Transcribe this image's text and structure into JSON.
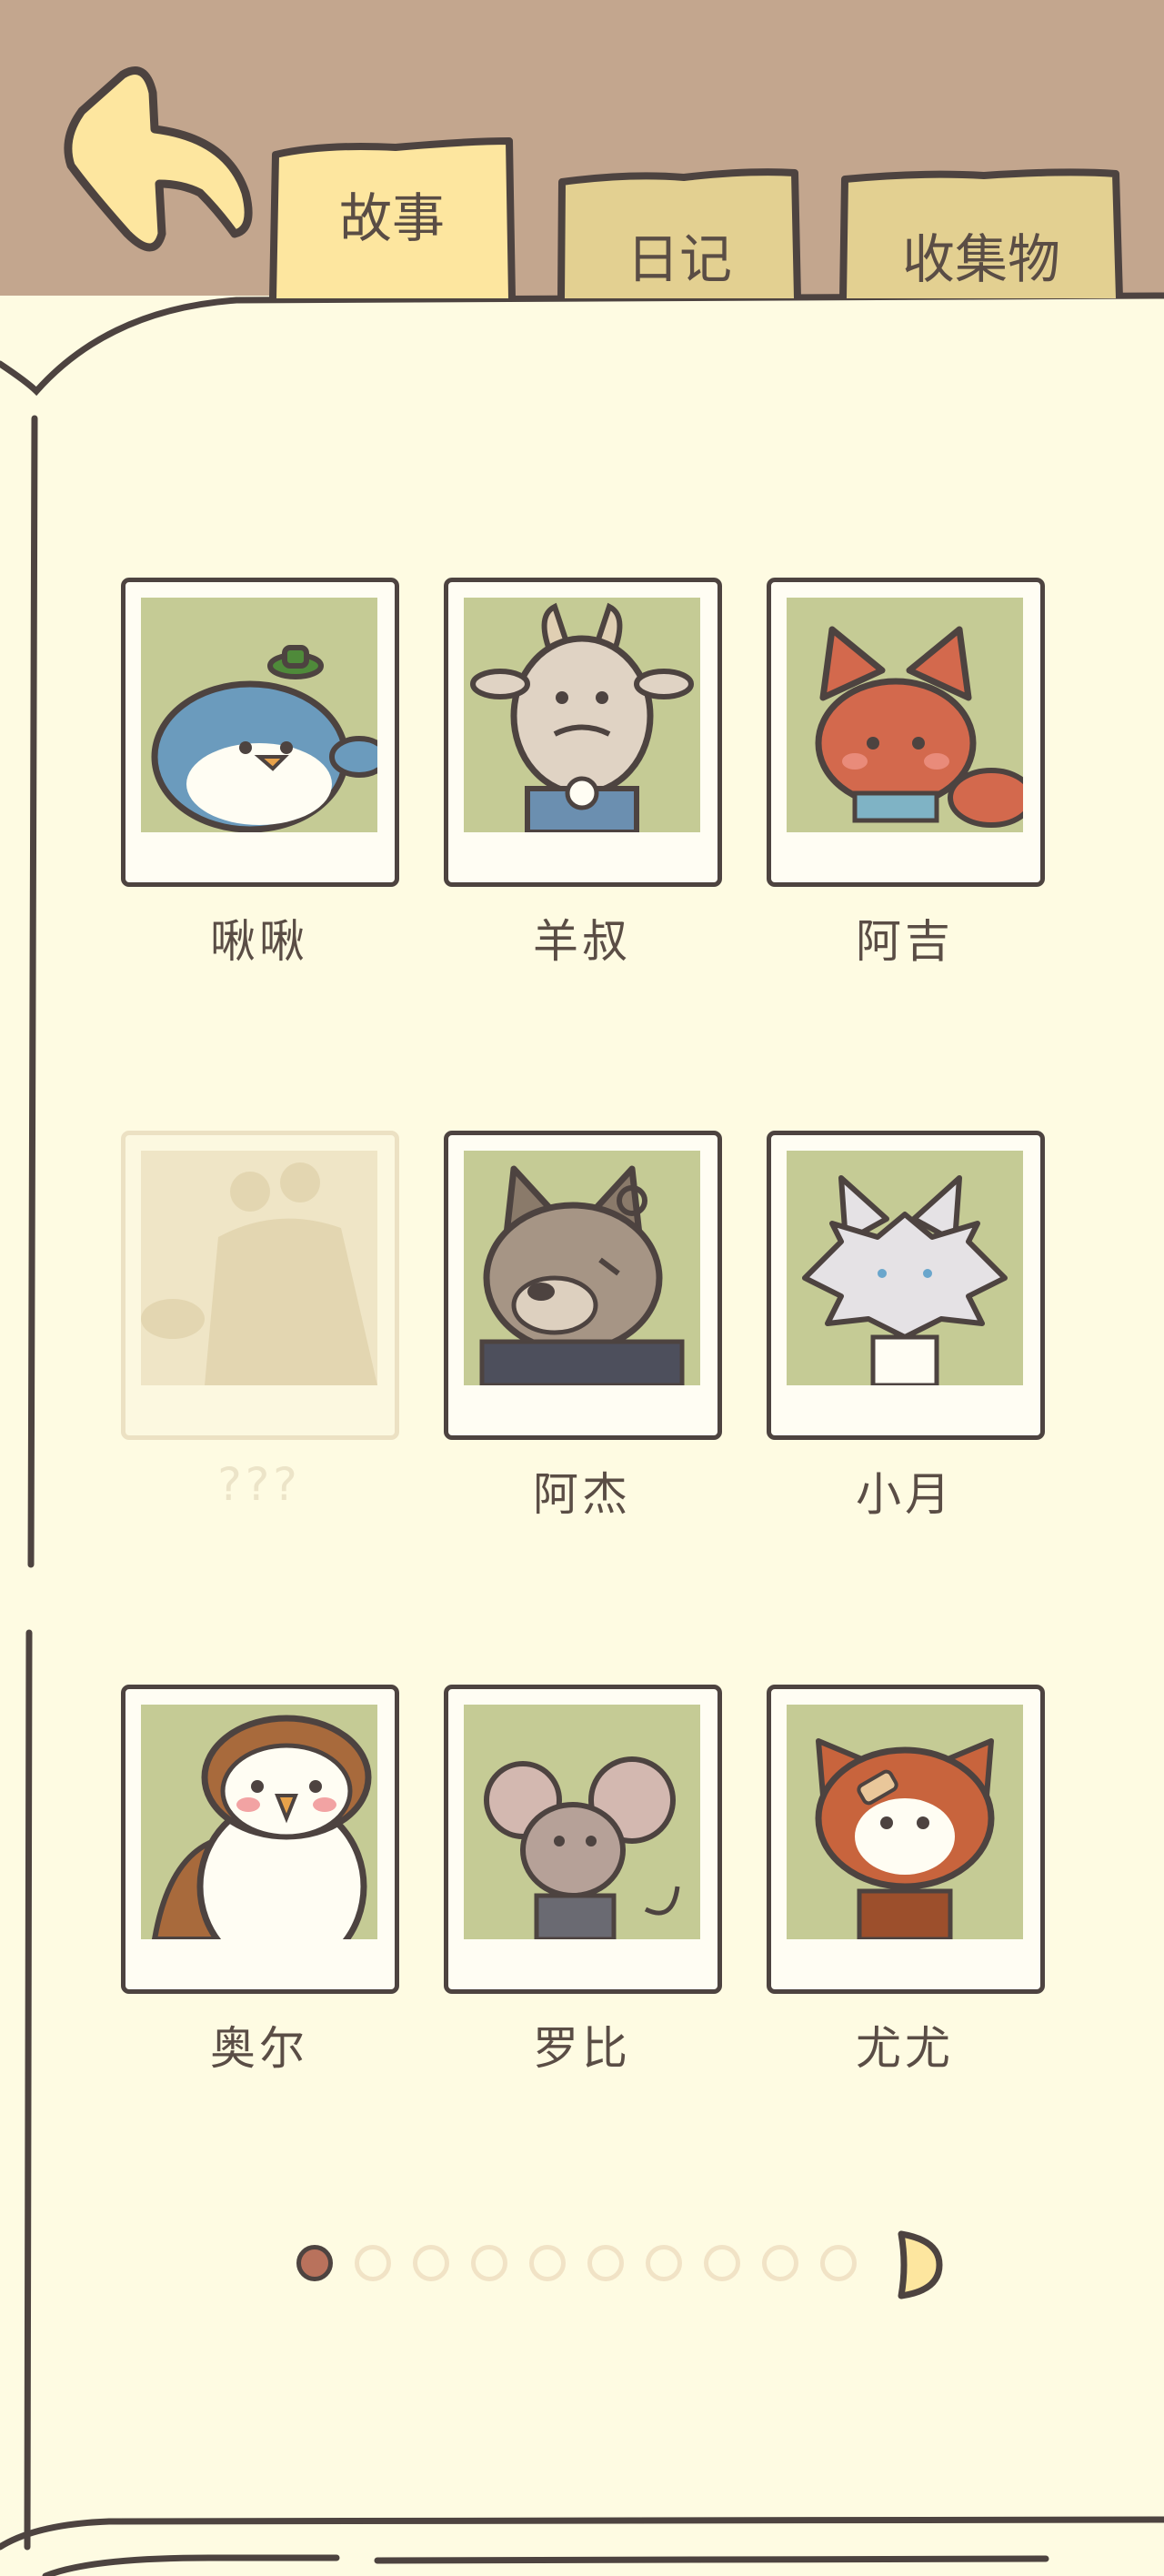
{
  "tabs": {
    "story": "故事",
    "diary": "日记",
    "collection": "收集物"
  },
  "characters": [
    {
      "name": "啾啾",
      "locked": false,
      "icon": "bluebird-icon"
    },
    {
      "name": "羊叔",
      "locked": false,
      "icon": "goat-icon"
    },
    {
      "name": "阿吉",
      "locked": false,
      "icon": "fox-icon"
    },
    {
      "name": "???",
      "locked": true,
      "icon": "silhouette-icon"
    },
    {
      "name": "阿杰",
      "locked": false,
      "icon": "wolf-icon"
    },
    {
      "name": "小月",
      "locked": false,
      "icon": "white-cat-icon"
    },
    {
      "name": "奥尔",
      "locked": false,
      "icon": "owl-icon"
    },
    {
      "name": "罗比",
      "locked": false,
      "icon": "mouse-icon"
    },
    {
      "name": "尤尤",
      "locked": false,
      "icon": "red-panda-icon"
    }
  ],
  "pagination": {
    "total_pages": 10,
    "current_page": 1
  },
  "colors": {
    "header_bg": "#c3a68e",
    "page_bg": "#fefbe2",
    "tab_active": "#fde69f",
    "tab_inactive": "#e3d091",
    "outline": "#4d4340",
    "photo_bg": "#c5cb95",
    "dot_active": "#b9725c"
  }
}
